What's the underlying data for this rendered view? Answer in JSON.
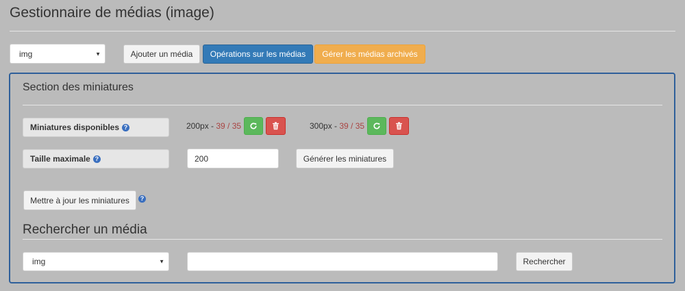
{
  "header": {
    "title": "Gestionnaire de médias (image)"
  },
  "toolbar": {
    "type_select_value": "img",
    "add_media_label": "Ajouter un média",
    "media_operations_label": "Opérations sur les médias",
    "archived_media_label": "Gérer les médias archivés"
  },
  "thumbnails": {
    "section_title": "Section des miniatures",
    "available_label": "Miniatures disponibles",
    "sizes": [
      {
        "size": "200px",
        "count": "39 / 35"
      },
      {
        "size": "300px",
        "count": "39 / 35"
      }
    ],
    "separator": " - ",
    "max_size_label": "Taille maximale",
    "max_size_value": "200",
    "generate_label": "Générer les miniatures",
    "update_label": "Mettre à jour les miniatures"
  },
  "search": {
    "section_title": "Rechercher un média",
    "type_select_value": "img",
    "query_value": "",
    "search_label": "Rechercher"
  },
  "icons": {
    "help": "question-circle-icon",
    "refresh": "refresh-icon",
    "delete": "trash-icon",
    "dropdown": "caret-down-icon"
  },
  "colors": {
    "primary": "#337ab7",
    "warning": "#f0ad4e",
    "success": "#5cb85c",
    "danger": "#d9534f",
    "count": "#a94442",
    "panel_border": "#2e5f9a"
  }
}
